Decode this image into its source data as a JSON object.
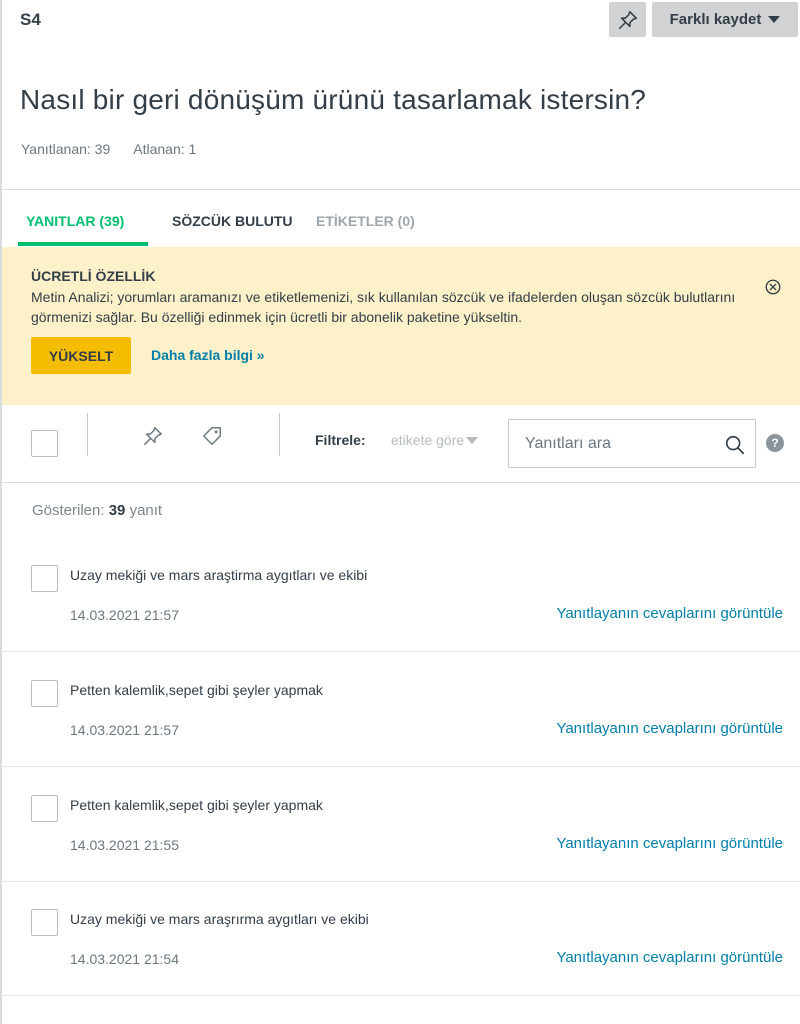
{
  "header": {
    "question_number": "S4",
    "save_label": "Farklı kaydet",
    "title": "Nasıl bir geri dönüşüm ürünü tasarlamak istersin?",
    "answered": "Yanıtlanan: 39",
    "skipped": "Atlanan: 1"
  },
  "tabs": {
    "answers": "YANITLAR (39)",
    "word_cloud": "SÖZCÜK BULUTU",
    "tags": "ETİKETLER (0)"
  },
  "banner": {
    "title": "ÜCRETLİ ÖZELLİK",
    "text": "Metin Analizi; yorumları aramanızı ve etiketlemenizi, sık kullanılan sözcük ve ifadelerden oluşan sözcük bulutlarını görmenizi sağlar. Bu özelliği edinmek için ücretli bir abonelik paketine yükseltin.",
    "upgrade_label": "YÜKSELT",
    "more_label": "Daha fazla bilgi »"
  },
  "toolbar": {
    "filter_label": "Filtrele:",
    "filter_value": "etikete göre",
    "search_placeholder": "Yanıtları ara",
    "help_glyph": "?"
  },
  "list": {
    "showing_prefix": "Gösterilen:",
    "showing_count": "39",
    "showing_suffix": "yanıt",
    "link_label": "Yanıtlayanın cevaplarını görüntüle",
    "rows": [
      {
        "text": "Uzay mekiği ve mars araştirma aygıtları ve ekibi",
        "date": "14.03.2021 21:57"
      },
      {
        "text": "Petten kalemlik,sepet gibi şeyler yapmak",
        "date": "14.03.2021 21:57"
      },
      {
        "text": "Petten kalemlik,sepet gibi şeyler yapmak",
        "date": "14.03.2021 21:55"
      },
      {
        "text": "Uzay mekiği ve mars araşrırma aygıtları ve ekibi",
        "date": "14.03.2021 21:54"
      }
    ]
  },
  "colors": {
    "accent": "#00bf6f",
    "link": "#007faa",
    "banner_bg": "#fcf1c9",
    "upgrade": "#f5bd00"
  }
}
